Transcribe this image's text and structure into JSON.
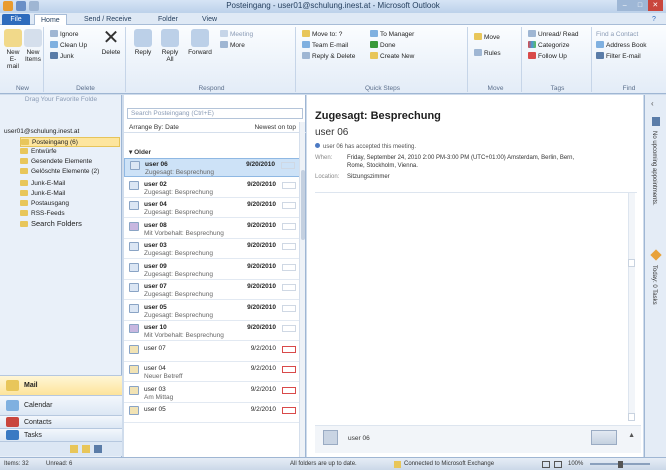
{
  "window": {
    "title": "Posteingang - user01@schulung.inest.at - Microsoft Outlook"
  },
  "tabs": [
    "File",
    "Home",
    "Send / Receive",
    "Folder",
    "View"
  ],
  "ribbon": {
    "new": {
      "label": "New",
      "new_email": "New E-mail",
      "new_items": "New Items"
    },
    "delete": {
      "label": "Delete",
      "ignore": "Ignore",
      "clean_up": "Clean Up",
      "junk": "Junk",
      "delete_btn": "Delete"
    },
    "respond": {
      "label": "Respond",
      "reply": "Reply",
      "reply_all": "Reply All",
      "forward": "Forward",
      "meeting": "Meeting",
      "more": "More"
    },
    "quick_steps": {
      "label": "Quick Steps",
      "move_to": "Move to: ?",
      "team_email": "Team E-mail",
      "reply_delete": "Reply & Delete",
      "to_manager": "To Manager",
      "done": "Done",
      "create_new": "Create New"
    },
    "move": {
      "label": "Move",
      "move_btn": "Move",
      "rules": "Rules"
    },
    "tags": {
      "label": "Tags",
      "unread_read": "Unread/ Read",
      "categorize": "Categorize",
      "follow_up": "Follow Up"
    },
    "find": {
      "label": "Find",
      "find_contact": "Find a Contact",
      "address_book": "Address Book",
      "filter_email": "Filter E-mail"
    }
  },
  "nav": {
    "favorites_hint": "Drag Your Favorite Folde",
    "account": "user01@schulung.inest.at",
    "folders": [
      {
        "name": "Posteingang (6)"
      },
      {
        "name": "Entwürfe"
      },
      {
        "name": "Gesendete Elemente"
      },
      {
        "name": "Gelöschte Elemente (2)"
      },
      {
        "name": "Junk-E-Mail"
      },
      {
        "name": "Junk-E-Mail"
      },
      {
        "name": "Postausgang"
      },
      {
        "name": "RSS-Feeds"
      },
      {
        "name": "Search Folders"
      }
    ],
    "buttons": [
      "Mail",
      "Calendar",
      "Contacts",
      "Tasks"
    ]
  },
  "list": {
    "search_placeholder": "Search Posteingang (Ctrl+E)",
    "arrange_by": "Arrange By: Date",
    "sort": "Newest on top",
    "group": "Older",
    "items": [
      {
        "from": "user 06",
        "subject": "Zugesagt: Besprechung",
        "date": "9/20/2010"
      },
      {
        "from": "user 02",
        "subject": "Zugesagt: Besprechung",
        "date": "9/20/2010"
      },
      {
        "from": "user 04",
        "subject": "Zugesagt: Besprechung",
        "date": "9/20/2010"
      },
      {
        "from": "user 08",
        "subject": "Mit Vorbehalt: Besprechung",
        "date": "9/20/2010"
      },
      {
        "from": "user 03",
        "subject": "Zugesagt: Besprechung",
        "date": "9/20/2010"
      },
      {
        "from": "user 09",
        "subject": "Zugesagt: Besprechung",
        "date": "9/20/2010"
      },
      {
        "from": "user 07",
        "subject": "Zugesagt: Besprechung",
        "date": "9/20/2010"
      },
      {
        "from": "user 05",
        "subject": "Zugesagt: Besprechung",
        "date": "9/20/2010"
      },
      {
        "from": "user 10",
        "subject": "Mit Vorbehalt: Besprechung",
        "date": "9/20/2010"
      },
      {
        "from": "user 07",
        "subject": "",
        "date": "9/2/2010"
      },
      {
        "from": "user 04",
        "subject": "Neuer Betreff",
        "date": "9/2/2010"
      },
      {
        "from": "user 03",
        "subject": "Am Mittag",
        "date": "9/2/2010"
      },
      {
        "from": "user 05",
        "subject": "",
        "date": "9/2/2010"
      }
    ]
  },
  "reading": {
    "subject": "Zugesagt: Besprechung",
    "from": "user 06",
    "info": "user 06 has accepted this meeting.",
    "when_label": "When:",
    "when": "Friday, September 24, 2010 2:00 PM-3:00 PM (UTC+01:00) Amsterdam, Berlin, Bern,",
    "when2": "Rome, Stockholm, Vienna.",
    "location_label": "Location:",
    "location": "Sitzungszimmer",
    "people_name": "user 06"
  },
  "todo": {
    "top": "No upcoming appointments.",
    "bottom": "Today: 0 Tasks"
  },
  "status": {
    "items": "Items: 32",
    "unread": "Unread: 6",
    "sync": "All folders are up to date.",
    "connection": "Connected to Microsoft Exchange",
    "zoom": "100%"
  }
}
